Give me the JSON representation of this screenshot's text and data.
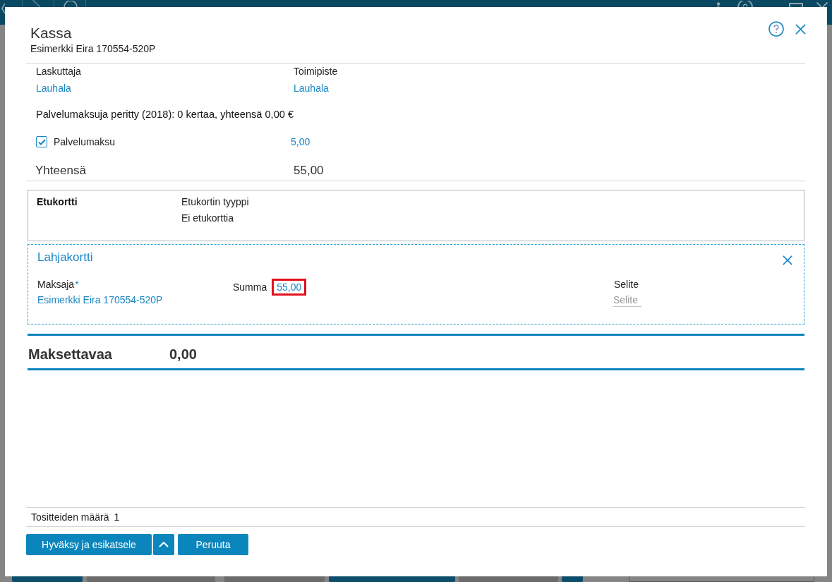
{
  "dialog": {
    "title": "Kassa",
    "subtitle": "Esimerkki Eira 170554-520P"
  },
  "billing": {
    "fields": [
      {
        "label": "Laskuttaja",
        "value": "Lauhala"
      },
      {
        "label": "Toimipiste",
        "value": "Lauhala"
      }
    ],
    "fees_note": "Palvelumaksuja peritty (2018): 0 kertaa, yhteensä 0,00 €",
    "service_fee": {
      "label": "Palvelumaksu",
      "checked": true,
      "amount": "5,00"
    },
    "total": {
      "label": "Yhteensä",
      "amount": "55,00"
    }
  },
  "benefit_card": {
    "title": "Etukortti",
    "type_label": "Etukortin tyyppi",
    "type_value": "Ei etukorttia"
  },
  "gift_card": {
    "title": "Lahjakortti",
    "payer": {
      "label": "Maksaja",
      "required_mark": "*",
      "value": "Esimerkki Eira 170554-520P"
    },
    "sum": {
      "label": "Summa",
      "value": "55,00",
      "highlighted": true
    },
    "note": {
      "label": "Selite",
      "placeholder": "Selite"
    }
  },
  "amount_due": {
    "label": "Maksettavaa",
    "amount": "0,00"
  },
  "footer": {
    "receipts_label": "Tositteiden määrä",
    "receipts_count": "1"
  },
  "buttons": [
    {
      "label": "Hyväksy ja esikatsele",
      "kind": "split"
    },
    {
      "label": "Peruuta",
      "kind": "plain"
    }
  ]
}
